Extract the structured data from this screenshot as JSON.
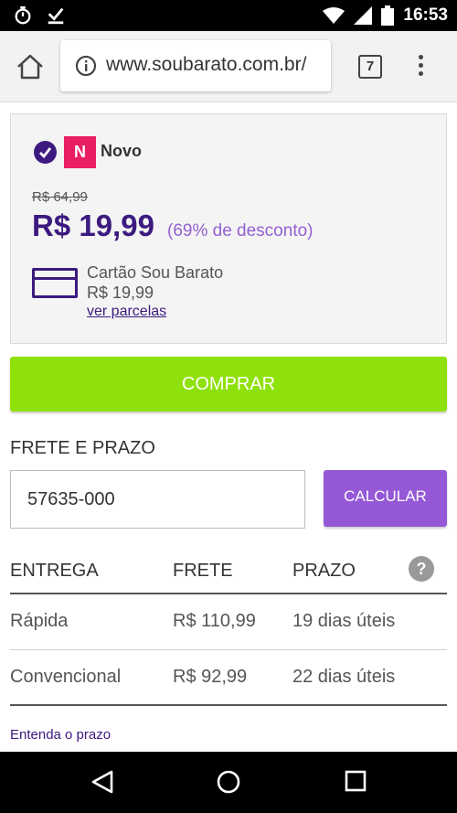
{
  "status_bar": {
    "time": "16:53"
  },
  "browser": {
    "url": "www.soubarato.com.br/",
    "tab_count": "7"
  },
  "offer": {
    "condition_badge": "N",
    "condition_label": "Novo",
    "old_price": "R$ 64,99",
    "price": "R$ 19,99",
    "discount": "(69% de desconto)",
    "card": {
      "name": "Cartão Sou Barato",
      "price": "R$ 19,99",
      "installments_link": "ver parcelas"
    }
  },
  "buy_button": "COMPRAR",
  "shipping": {
    "title": "FRETE E PRAZO",
    "cep_value": "57635-000",
    "calculate_button": "CALCULAR",
    "headers": [
      "ENTREGA",
      "FRETE",
      "PRAZO"
    ],
    "help": "?",
    "rows": [
      {
        "type": "Rápida",
        "price": "R$ 110,99",
        "time": "19 dias úteis"
      },
      {
        "type": "Convencional",
        "price": "R$ 92,99",
        "time": "22 dias úteis"
      }
    ],
    "info_link": "Entenda o prazo"
  },
  "colors": {
    "brand_purple": "#3c1a7f",
    "light_purple": "#9558d6",
    "buy_green": "#8fe10b",
    "badge_pink": "#e91e63"
  }
}
